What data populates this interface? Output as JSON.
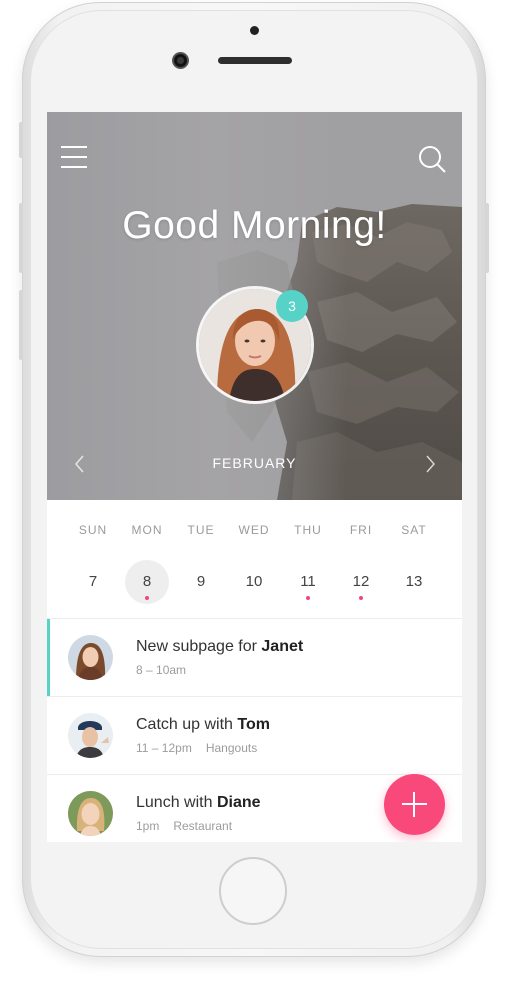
{
  "header": {
    "greeting": "Good Morning!",
    "notification_count": "3",
    "month": "FEBRUARY"
  },
  "week": [
    {
      "day": "SUN",
      "date": "7",
      "selected": false,
      "has_event": false
    },
    {
      "day": "MON",
      "date": "8",
      "selected": true,
      "has_event": true
    },
    {
      "day": "TUE",
      "date": "9",
      "selected": false,
      "has_event": false
    },
    {
      "day": "WED",
      "date": "10",
      "selected": false,
      "has_event": false
    },
    {
      "day": "THU",
      "date": "11",
      "selected": false,
      "has_event": true
    },
    {
      "day": "FRI",
      "date": "12",
      "selected": false,
      "has_event": true
    },
    {
      "day": "SAT",
      "date": "13",
      "selected": false,
      "has_event": false
    }
  ],
  "events": [
    {
      "title": "New subpage for ",
      "person": "Janet",
      "time": "8 – 10am",
      "place": ""
    },
    {
      "title": "Catch up with ",
      "person": "Tom",
      "time": "11 – 12pm",
      "place": "Hangouts"
    },
    {
      "title": "Lunch with ",
      "person": "Diane",
      "time": "1pm",
      "place": "Restaurant"
    }
  ],
  "colors": {
    "accent_teal": "#56d2c7",
    "fab_pink": "#f9497b",
    "event_dot": "#ef4a74"
  },
  "icons": {
    "menu": "hamburger-icon",
    "search": "search-icon",
    "prev": "chevron-left-icon",
    "next": "chevron-right-icon",
    "add": "plus-icon"
  }
}
